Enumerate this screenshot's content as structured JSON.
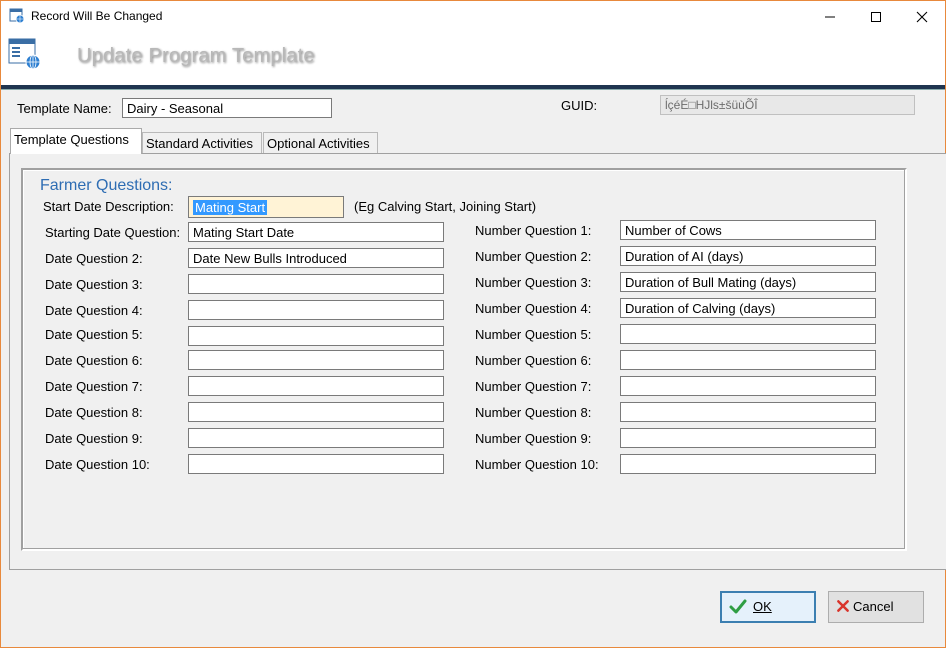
{
  "window": {
    "title": "Record Will Be Changed",
    "controls": {
      "minimize": "—",
      "maximize": "☐",
      "close": "✕"
    }
  },
  "header": {
    "title": "Update Program Template"
  },
  "template_name": {
    "label": "Template Name:",
    "value": "Dairy - Seasonal"
  },
  "guid": {
    "label": "GUID:",
    "value": "ĺçéÉ□HJls±šüùÕÎ"
  },
  "tabs": [
    {
      "label": "Template Questions",
      "active": true
    },
    {
      "label": "Standard Activities",
      "active": false
    },
    {
      "label": "Optional Activities",
      "active": false
    }
  ],
  "farmer_questions": {
    "title": "Farmer Questions:",
    "start_date_description": {
      "label": "Start Date Description:",
      "value": "Mating Start",
      "hint": "(Eg Calving Start, Joining Start)"
    },
    "date_questions": [
      {
        "label": "Starting Date Question:",
        "value": "Mating Start Date"
      },
      {
        "label": "Date Question 2:",
        "value": "Date New Bulls Introduced"
      },
      {
        "label": "Date Question 3:",
        "value": ""
      },
      {
        "label": "Date Question 4:",
        "value": ""
      },
      {
        "label": "Date Question 5:",
        "value": ""
      },
      {
        "label": "Date Question 6:",
        "value": ""
      },
      {
        "label": "Date Question 7:",
        "value": ""
      },
      {
        "label": "Date Question 8:",
        "value": ""
      },
      {
        "label": "Date Question 9:",
        "value": ""
      },
      {
        "label": "Date Question 10:",
        "value": ""
      }
    ],
    "number_questions": [
      {
        "label": "Number Question 1:",
        "value": "Number of  Cows"
      },
      {
        "label": "Number Question 2:",
        "value": "Duration of AI (days)"
      },
      {
        "label": "Number Question 3:",
        "value": "Duration of Bull Mating (days)"
      },
      {
        "label": "Number Question 4:",
        "value": "Duration of Calving (days)"
      },
      {
        "label": "Number Question 5:",
        "value": ""
      },
      {
        "label": "Number Question 6:",
        "value": ""
      },
      {
        "label": "Number Question 7:",
        "value": ""
      },
      {
        "label": "Number Question 8:",
        "value": ""
      },
      {
        "label": "Number Question 9:",
        "value": ""
      },
      {
        "label": "Number Question 10:",
        "value": ""
      }
    ]
  },
  "buttons": {
    "ok": "OK",
    "cancel": "Cancel"
  },
  "colors": {
    "accent": "#2e6db3",
    "header_bar": "#1f3550",
    "window_border": "#e8893c",
    "ok_check": "#2f9e44",
    "cancel_x": "#d9342b"
  }
}
